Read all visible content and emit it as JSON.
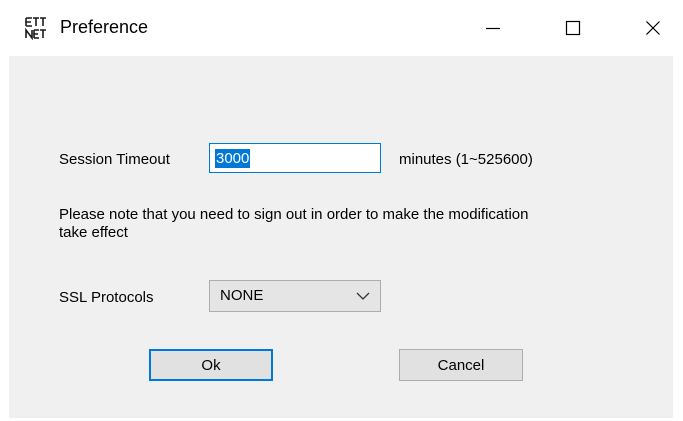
{
  "window": {
    "title": "Preference",
    "app_icon_text": "ETT NET"
  },
  "form": {
    "session_timeout_label": "Session Timeout",
    "session_timeout_value": "3000",
    "minutes_range_label": "minutes (1~525600)",
    "note": "Please note that you need to sign out in order to make the modification take effect",
    "ssl_label": "SSL Protocols",
    "ssl_selected": "NONE"
  },
  "buttons": {
    "ok": "Ok",
    "cancel": "Cancel"
  },
  "colors": {
    "accent": "#0078d7",
    "client_bg": "#f0f0f0"
  }
}
